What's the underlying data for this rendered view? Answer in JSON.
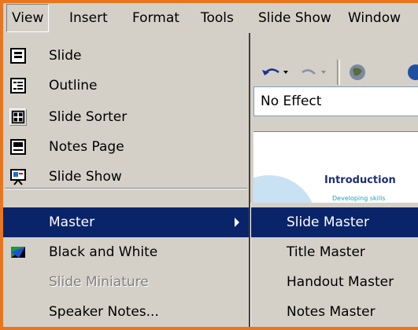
{
  "menubar": {
    "items": [
      {
        "label": "View"
      },
      {
        "label": "Insert"
      },
      {
        "label": "Format"
      },
      {
        "label": "Tools"
      },
      {
        "label": "Slide Show"
      },
      {
        "label": "Window"
      }
    ]
  },
  "toolbar": {
    "effect_value": "No Effect"
  },
  "slide": {
    "title": "Introduction",
    "bullet": "Developing skills"
  },
  "view_menu": {
    "items": [
      {
        "label": "Slide",
        "icon": "slide-icon"
      },
      {
        "label": "Outline",
        "icon": "outline-icon"
      },
      {
        "label": "Slide Sorter",
        "icon": "slide-sorter-icon"
      },
      {
        "label": "Notes Page",
        "icon": "notes-page-icon"
      },
      {
        "label": "Slide Show",
        "icon": "slide-show-icon"
      },
      {
        "label": "Master",
        "icon": "",
        "submenu": true
      },
      {
        "label": "Black and White",
        "icon": "black-white-icon"
      },
      {
        "label": "Slide Miniature",
        "icon": "",
        "disabled": true
      },
      {
        "label": "Speaker Notes...",
        "icon": ""
      }
    ]
  },
  "master_submenu": {
    "items": [
      {
        "label": "Slide Master"
      },
      {
        "label": "Title Master"
      },
      {
        "label": "Handout Master"
      },
      {
        "label": "Notes Master"
      }
    ]
  },
  "colors": {
    "highlight": "#0a246a",
    "frame": "#e8761f",
    "menu_bg": "#d4d0c8"
  }
}
